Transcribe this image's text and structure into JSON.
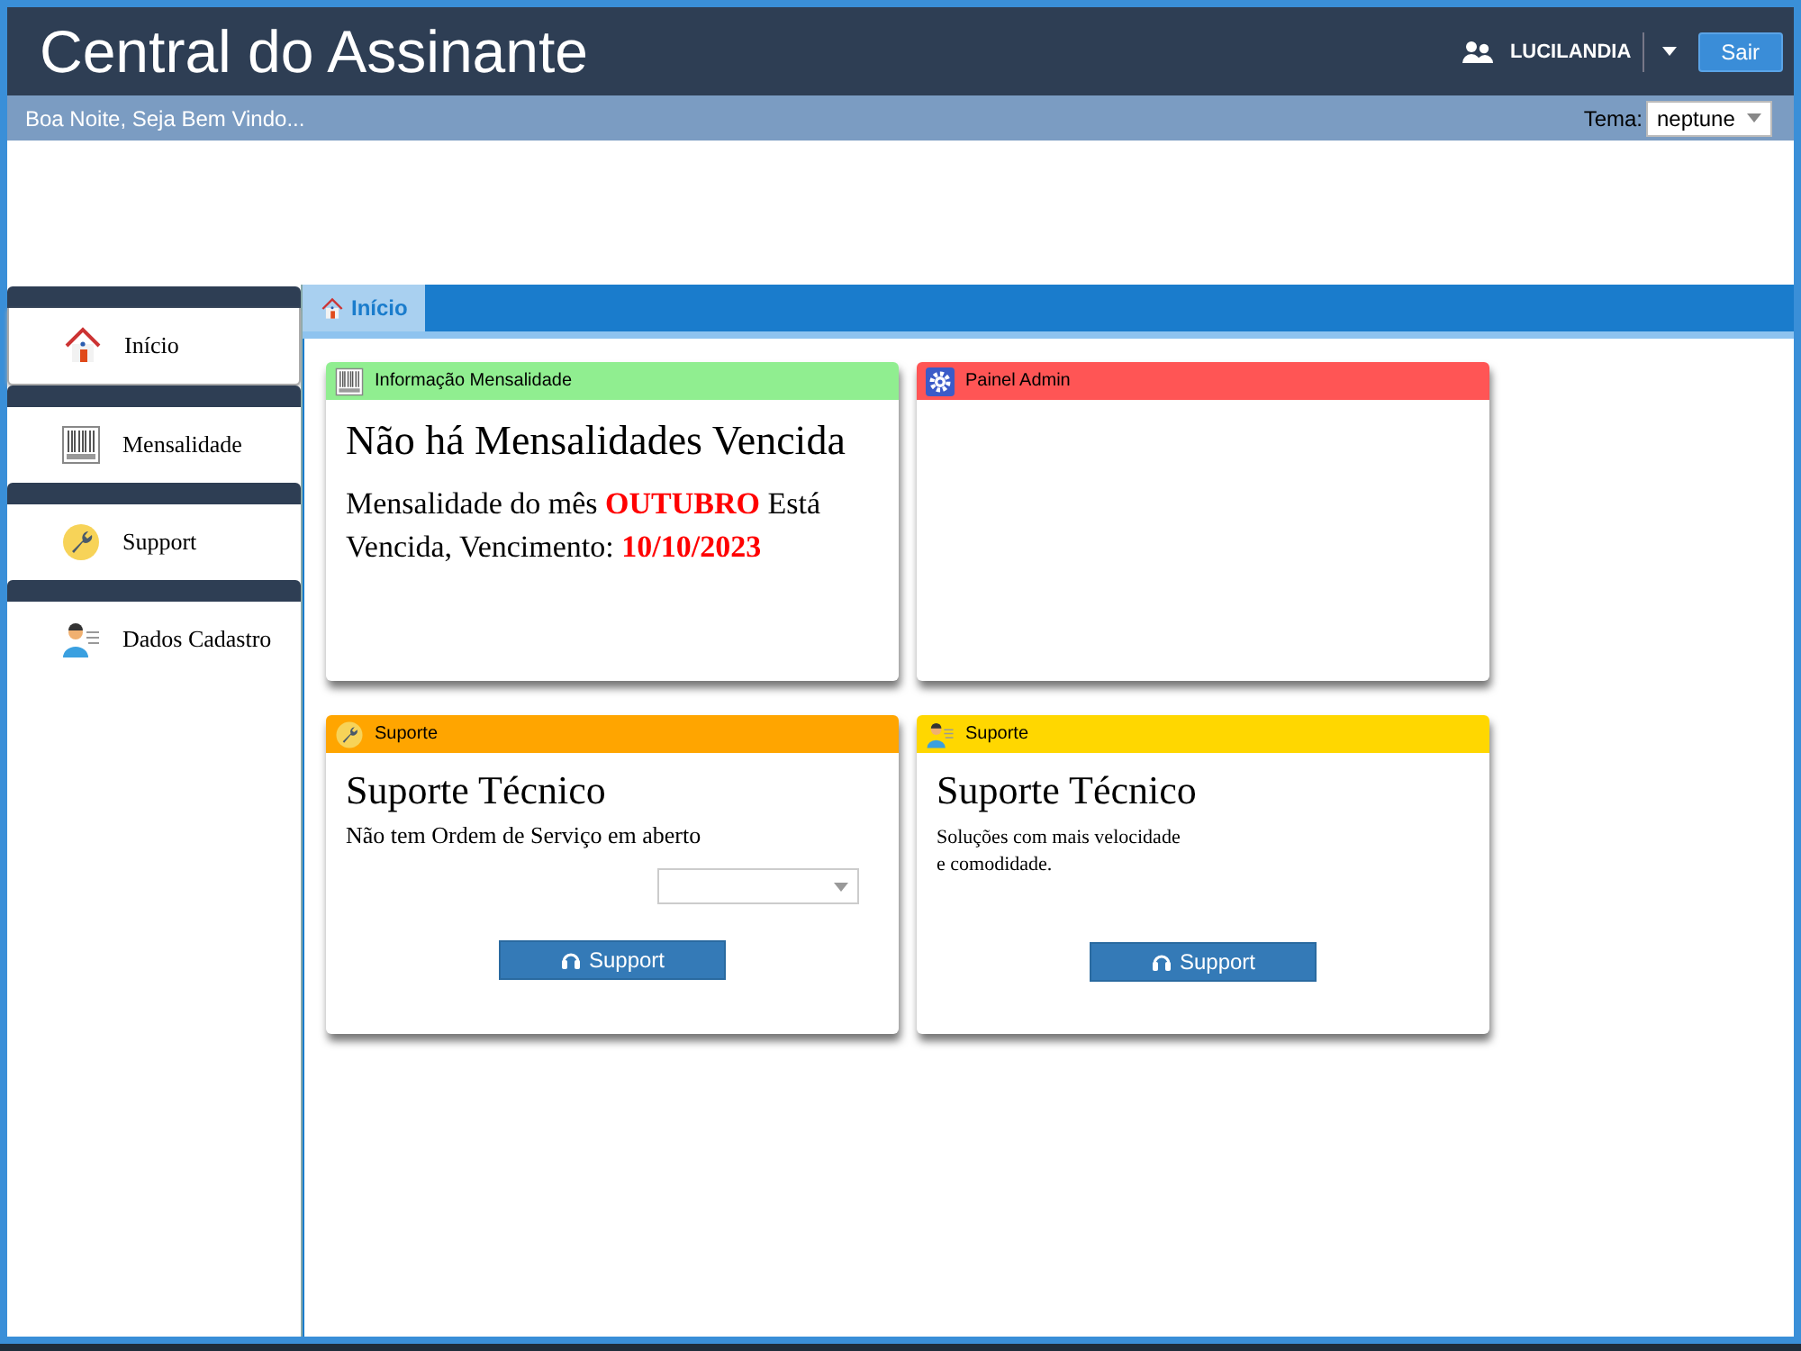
{
  "header": {
    "title": "Central do Assinante",
    "user": "LUCILANDIA",
    "logout_button": "Sair"
  },
  "subheader": {
    "greeting": "Boa Noite, Seja Bem Vindo...",
    "theme_label": "Tema:",
    "theme_value": "neptune"
  },
  "sidebar": {
    "items": [
      {
        "label": "Início",
        "selected": true
      },
      {
        "label": "Mensalidade",
        "selected": false
      },
      {
        "label": "Support",
        "selected": false
      },
      {
        "label": "Dados Cadastro",
        "selected": false
      }
    ]
  },
  "tabs": [
    {
      "label": "Início",
      "selected": true
    }
  ],
  "cards": [
    {
      "kind": "billing",
      "title": "Informação Mensalidade",
      "color": "#90ee90",
      "heading": "Não há Mensalidades Vencida",
      "message": "Mensalidade do mês **OUTUBRO** Está Vencida, Vencimento: **10/10/2023**"
    },
    {
      "kind": "empty",
      "title": "Painel Admin",
      "color": "#ff5555"
    },
    {
      "kind": "support_select",
      "title": "Suporte",
      "color": "#ffa500",
      "heading": "Suporte Técnico",
      "text": "Não tem Ordem de Serviço em aberto",
      "button": "Support"
    },
    {
      "kind": "support_info",
      "title": "Suporte",
      "color": "#ffd700",
      "heading": "Suporte Técnico",
      "lines": [
        "Soluções com mais velocidade",
        "e comodidade."
      ],
      "button": "Support"
    }
  ]
}
